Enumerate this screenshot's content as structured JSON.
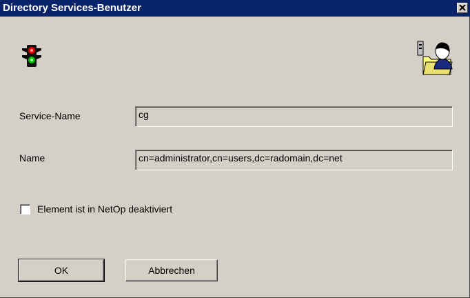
{
  "window": {
    "title": "Directory Services-Benutzer",
    "close_symbol": "×"
  },
  "icons": {
    "status": "traffic-light-icon",
    "user": "directory-user-icon"
  },
  "fields": {
    "service_name_label": "Service-Name",
    "service_name_value": "cg",
    "name_label": "Name",
    "name_value": "cn=administrator,cn=users,dc=radomain,dc=net"
  },
  "checkbox": {
    "label": "Element ist in NetOp deaktiviert",
    "checked": false
  },
  "buttons": {
    "ok_label": "OK",
    "cancel_label": "Abbrechen"
  },
  "colors": {
    "title_bar": "#0a246a",
    "dialog_face": "#d4d0c8"
  }
}
